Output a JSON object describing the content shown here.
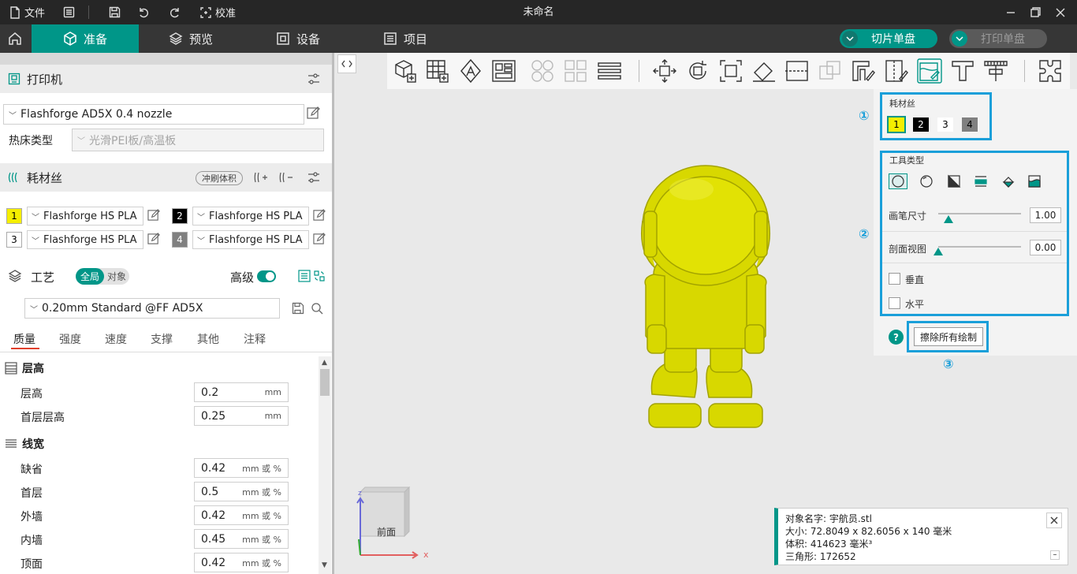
{
  "titlebar": {
    "file_label": "文件",
    "calibrate_label": "校准",
    "window_title": "未命名"
  },
  "nav": {
    "tabs": [
      {
        "label": "准备",
        "icon": "cube-icon"
      },
      {
        "label": "预览",
        "icon": "layers-icon"
      },
      {
        "label": "设备",
        "icon": "device-icon"
      },
      {
        "label": "项目",
        "icon": "list-icon"
      }
    ],
    "slice_label": "切片单盘",
    "print_label": "打印单盘",
    "accent": "#009688"
  },
  "printer": {
    "title": "打印机",
    "profile": "Flashforge AD5X 0.4 nozzle",
    "bed_label": "热床类型",
    "bed_value": "光滑PEI板/高温板"
  },
  "filament": {
    "title": "耗材丝",
    "flush_label": "冲刷体积",
    "slots": [
      {
        "num": "1",
        "name": "Flashforge HS PLA",
        "color": "#f5ee00",
        "text": "#000"
      },
      {
        "num": "2",
        "name": "Flashforge HS PLA",
        "color": "#000000",
        "text": "#fff"
      },
      {
        "num": "3",
        "name": "Flashforge HS PLA",
        "color": "#ffffff",
        "text": "#000"
      },
      {
        "num": "4",
        "name": "Flashforge HS PLA",
        "color": "#808080",
        "text": "#fff"
      }
    ]
  },
  "process": {
    "title": "工艺",
    "global_label": "全局",
    "object_label": "对象",
    "advanced_label": "高级",
    "preset": "0.20mm Standard @FF AD5X",
    "tabs": [
      "质量",
      "强度",
      "速度",
      "支撑",
      "其他",
      "注释"
    ],
    "groups": [
      {
        "title": "层高",
        "rows": [
          {
            "label": "层高",
            "value": "0.2",
            "unit": "mm"
          },
          {
            "label": "首层层高",
            "value": "0.25",
            "unit": "mm"
          }
        ]
      },
      {
        "title": "线宽",
        "rows": [
          {
            "label": "缺省",
            "value": "0.42",
            "unit": "mm 或 %"
          },
          {
            "label": "首层",
            "value": "0.5",
            "unit": "mm 或 %"
          },
          {
            "label": "外墙",
            "value": "0.42",
            "unit": "mm 或 %"
          },
          {
            "label": "内墙",
            "value": "0.45",
            "unit": "mm 或 %"
          },
          {
            "label": "顶面",
            "value": "0.42",
            "unit": "mm 或 %"
          }
        ]
      }
    ]
  },
  "paint": {
    "filament_label": "耗材丝",
    "swatches": [
      {
        "num": "1",
        "color": "#f5ee00",
        "text": "#000"
      },
      {
        "num": "2",
        "color": "#000000",
        "text": "#fff"
      },
      {
        "num": "3",
        "color": "#ffffff",
        "text": "#000"
      },
      {
        "num": "4",
        "color": "#808080",
        "text": "#000"
      }
    ],
    "tool_type_label": "工具类型",
    "tools": [
      "circle-tool-icon",
      "sphere-tool-icon",
      "triangle-tool-icon",
      "height-range-tool-icon",
      "fill-tool-icon",
      "gap-fill-tool-icon"
    ],
    "pen_size_label": "画笔尺寸",
    "pen_size_value": "1.00",
    "pen_size_level": 0.12,
    "section_label": "剖面视图",
    "section_value": "0.00",
    "section_level": 0.0,
    "vertical_label": "垂直",
    "horizontal_label": "水平",
    "erase_label": "擦除所有绘制",
    "annotations": [
      "①",
      "②",
      "③"
    ],
    "highlight_color": "#1a9fd9"
  },
  "viewcube": {
    "face_label": "前面",
    "axis_x": "x",
    "axis_z": "z"
  },
  "object_info": {
    "name_line": "对象名字:  宇航员.stl",
    "size_line": "大小:   72.8049 x 82.6056 x 140 毫米",
    "volume_line": "体积:   414623 毫米³",
    "triangles_line": "三角形:  172652"
  },
  "model_color": "#d8d800"
}
